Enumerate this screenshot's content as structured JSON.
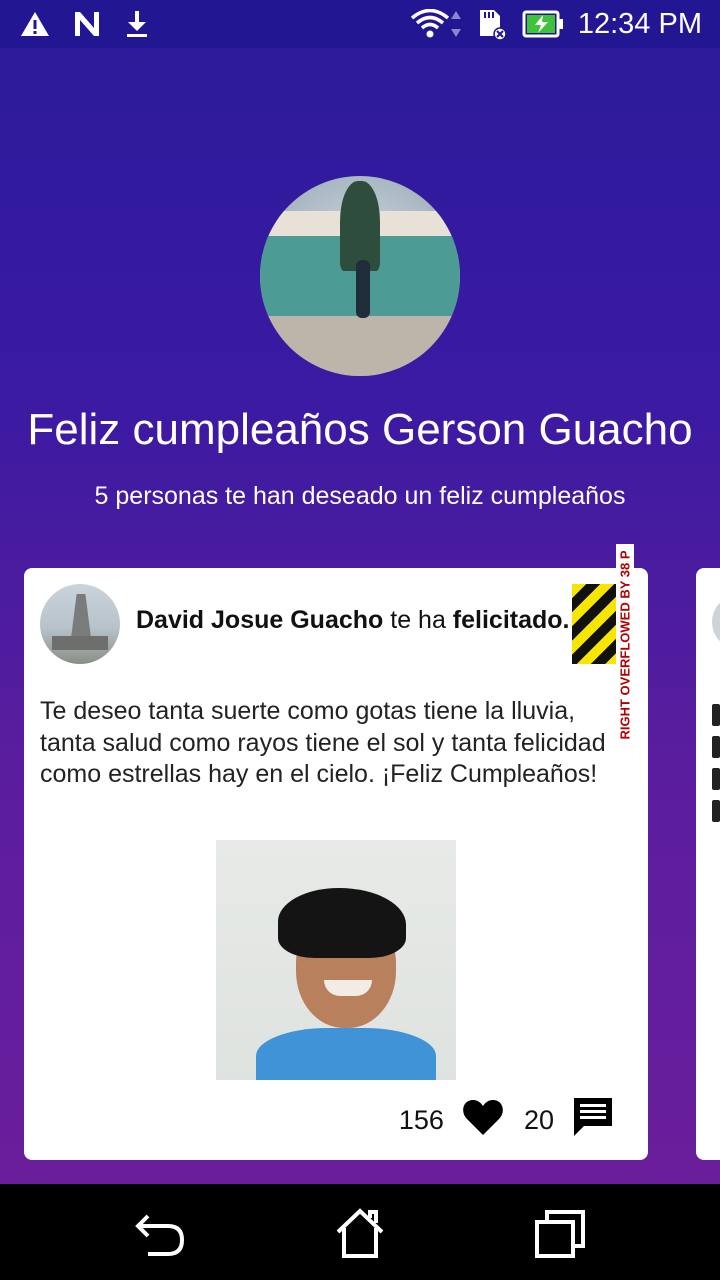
{
  "status_bar": {
    "time": "12:34 PM",
    "icons": [
      "warning-icon",
      "n-notification-icon",
      "download-icon",
      "wifi-icon",
      "sd-card-icon",
      "battery-charging-icon"
    ]
  },
  "header": {
    "title": "Feliz cumpleaños Gerson Guacho",
    "subtitle": "5 personas te han deseado un feliz cumpleaños"
  },
  "card": {
    "author_name": "David Josue Guacho",
    "action_connector": " te ha ",
    "action_word": "felicitado.",
    "overflow_notice": "RIGHT OVERFLOWED BY 38 P",
    "message": "Te deseo tanta suerte como gotas tiene la lluvia, tanta salud como rayos tiene el sol y tanta felicidad como estrellas hay en el cielo. ¡Feliz Cumpleaños!",
    "likes": "156",
    "comments": "20"
  },
  "nav": [
    "back-icon",
    "home-icon",
    "recents-icon"
  ]
}
